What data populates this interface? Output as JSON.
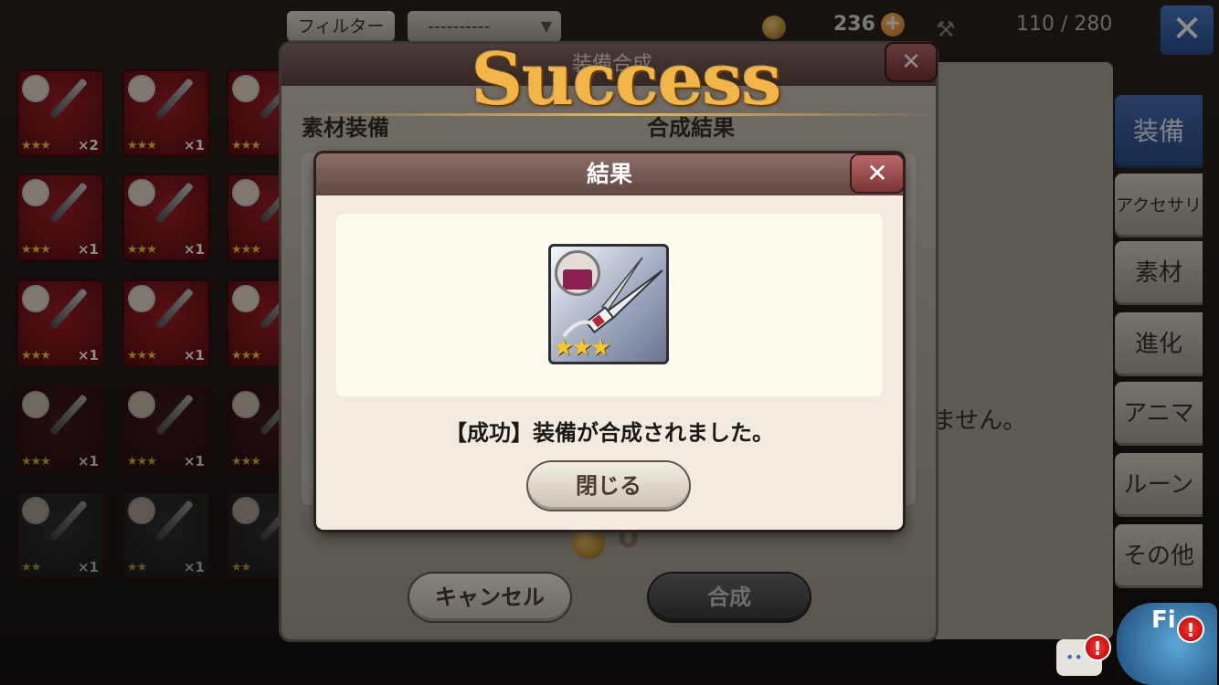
{
  "topbar": {
    "filter_label": "フィルター",
    "select_value": "----------",
    "currency": "236",
    "plus": "+",
    "capacity": "110 / 280",
    "close_symbol": "✕"
  },
  "inventory": {
    "items": [
      {
        "stars": "★★★",
        "count": "×2",
        "style": "red"
      },
      {
        "stars": "★★★",
        "count": "×1",
        "style": "red"
      },
      {
        "stars": "★★★",
        "count": "",
        "style": "red"
      },
      {
        "stars": "★★★",
        "count": "×1",
        "style": "red"
      },
      {
        "stars": "★★★",
        "count": "×1",
        "style": "red"
      },
      {
        "stars": "★★★",
        "count": "",
        "style": "red"
      },
      {
        "stars": "★★★",
        "count": "×1",
        "style": "red"
      },
      {
        "stars": "★★★",
        "count": "×1",
        "style": "red"
      },
      {
        "stars": "★★★",
        "count": "",
        "style": "red"
      },
      {
        "stars": "★★★",
        "count": "×1",
        "style": "dark"
      },
      {
        "stars": "★★★",
        "count": "×1",
        "style": "dark"
      },
      {
        "stars": "★★★",
        "count": "",
        "style": "dark"
      },
      {
        "stars": "★★",
        "count": "×1",
        "style": "grey"
      },
      {
        "stars": "★★",
        "count": "×1",
        "style": "grey"
      },
      {
        "stars": "★★",
        "count": "",
        "style": "grey"
      }
    ]
  },
  "side_tabs": [
    {
      "label": "装備",
      "active": true
    },
    {
      "label": "アクセサリ",
      "active": false
    },
    {
      "label": "素材",
      "active": false
    },
    {
      "label": "進化",
      "active": false
    },
    {
      "label": "アニマ",
      "active": false
    },
    {
      "label": "ルーン",
      "active": false
    },
    {
      "label": "その他",
      "active": false
    }
  ],
  "synthesis": {
    "title": "装備合成",
    "material_label": "素材装備",
    "result_label": "合成結果",
    "bg_text": "ません。",
    "cost": "0",
    "cancel_label": "キャンセル",
    "synth_label": "合成",
    "close_symbol": "✕"
  },
  "banner": {
    "text": "Success"
  },
  "result_dialog": {
    "title": "結果",
    "close_symbol": "✕",
    "item_stars": "★★★",
    "message": "【成功】装備が合成されました。",
    "close_label": "閉じる"
  },
  "widgets": {
    "alert": "!",
    "field_text": "Fi"
  },
  "colors": {
    "accent_blue": "#2c4b86",
    "header_brown": "#5f4643",
    "success_gold": "#f3b54a",
    "alert_red": "#d81a1a"
  }
}
